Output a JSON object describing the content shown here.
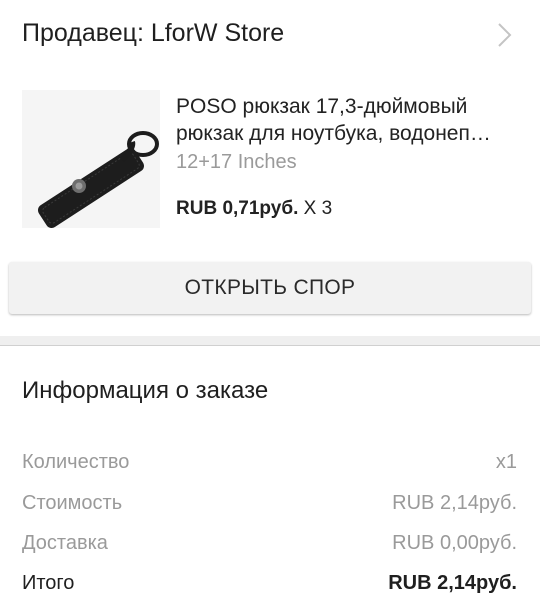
{
  "seller": {
    "label": "Продавец: LforW Store",
    "chevron_icon": "chevron-right-icon"
  },
  "product": {
    "title_line1": "POSO рюкзак 17,3-дюймовый",
    "title_line2": "рюкзак для ноутбука, водонеп…",
    "variant": "12+17 Inches",
    "price": "RUB 0,71руб.",
    "quantity": "X 3",
    "image_icon": "keychain-strap-image"
  },
  "dispute_button": {
    "label": "ОТКРЫТЬ СПОР"
  },
  "order_info": {
    "title": "Информация о заказе",
    "rows": [
      {
        "label": "Количество",
        "value": "x1"
      },
      {
        "label": "Стоимость",
        "value": "RUB 2,14руб."
      },
      {
        "label": "Доставка",
        "value": "RUB 0,00руб."
      },
      {
        "label": "Итого",
        "value": "RUB 2,14руб."
      }
    ]
  },
  "colors": {
    "text_primary": "#1f1f1f",
    "text_secondary": "#9a9a9a",
    "button_bg": "#f2f2f2",
    "divider": "#efefef"
  }
}
